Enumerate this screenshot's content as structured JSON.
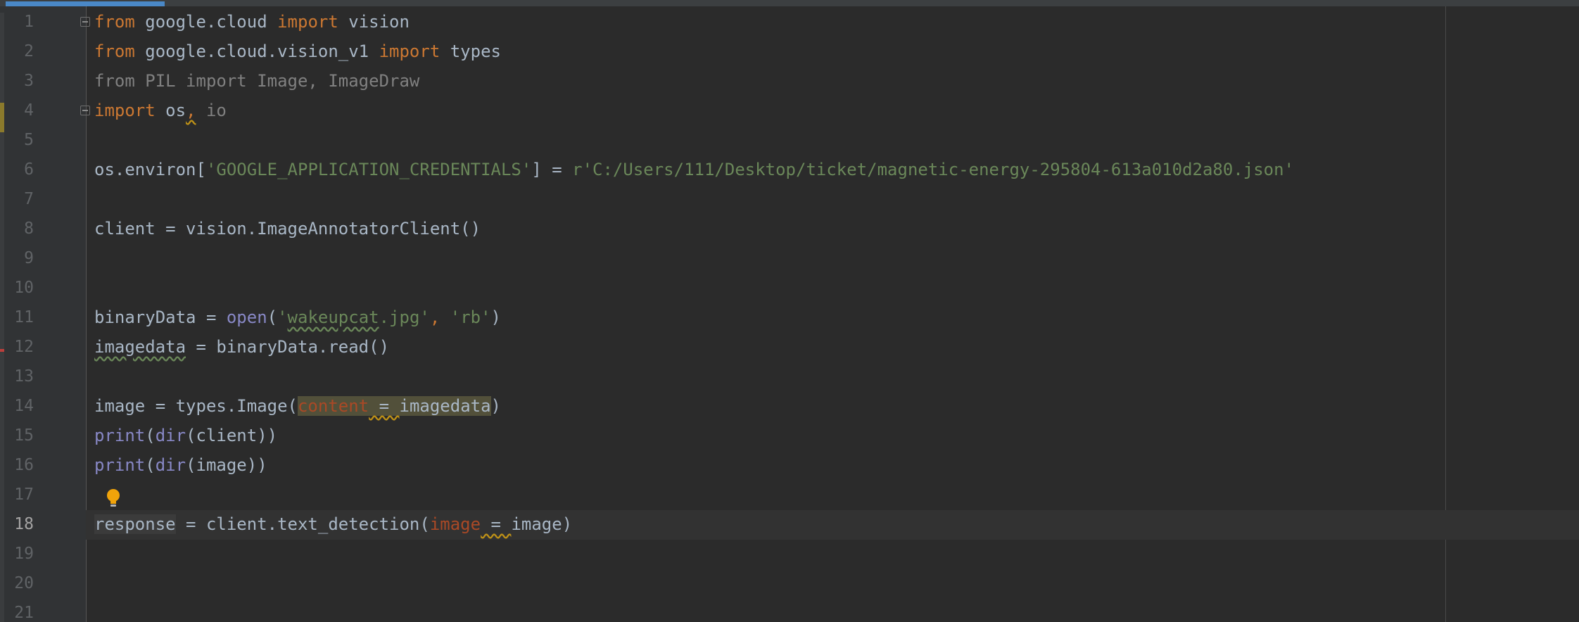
{
  "gutter": {
    "line_numbers": [
      "1",
      "2",
      "3",
      "4",
      "5",
      "6",
      "7",
      "8",
      "9",
      "10",
      "11",
      "12",
      "13",
      "14",
      "15",
      "16",
      "17",
      "18",
      "19",
      "20",
      "21"
    ],
    "current_line": "18"
  },
  "code": {
    "l1": {
      "a": "from",
      "b": " google.cloud ",
      "c": "import",
      "d": " vision"
    },
    "l2": {
      "a": "from",
      "b": " google.cloud.vision_v1 ",
      "c": "import",
      "d": " types"
    },
    "l3": {
      "text": "from PIL import Image, ImageDraw"
    },
    "l4": {
      "a": "import",
      "b": " os",
      "c": ",",
      "d": " io"
    },
    "l6": {
      "a": "os.environ[",
      "b": "'GOOGLE_APPLICATION_CREDENTIALS'",
      "c": "] = ",
      "d": "r'C:/Users/111/Desktop/ticket/magnetic-energy-295804-613a010d2a80.json'"
    },
    "l8": {
      "text": "client = vision.ImageAnnotatorClient()"
    },
    "l11": {
      "a": "binaryData = ",
      "b": "open",
      "c": "(",
      "d": "'",
      "e": "wakeupcat",
      "f": ".jpg'",
      "g": ", ",
      "h": "'rb'",
      "i": ")"
    },
    "l12": {
      "a": "imagedata",
      "b": " = binaryData.read()"
    },
    "l14": {
      "a": "image = types.Image(",
      "b": "content",
      "c": " = ",
      "d": "imagedata",
      "e": ")"
    },
    "l15": {
      "a": "print",
      "b": "(",
      "c": "dir",
      "d": "(client))"
    },
    "l16": {
      "a": "print",
      "b": "(",
      "c": "dir",
      "d": "(image))"
    },
    "l18": {
      "a": "response",
      "b": " = client.text_detection(",
      "c": "image",
      "d": " = ",
      "e": "image",
      "f": ")"
    }
  },
  "colors": {
    "background": "#2b2b2b",
    "keyword": "#cc7832",
    "string": "#6a8759",
    "identifier": "#a9b7c6",
    "builtin": "#8888c6",
    "parameter": "#aa4926",
    "unused_import": "#808080"
  },
  "icons": {
    "intention": "lightbulb-icon",
    "fold": "fold-marker-icon"
  }
}
